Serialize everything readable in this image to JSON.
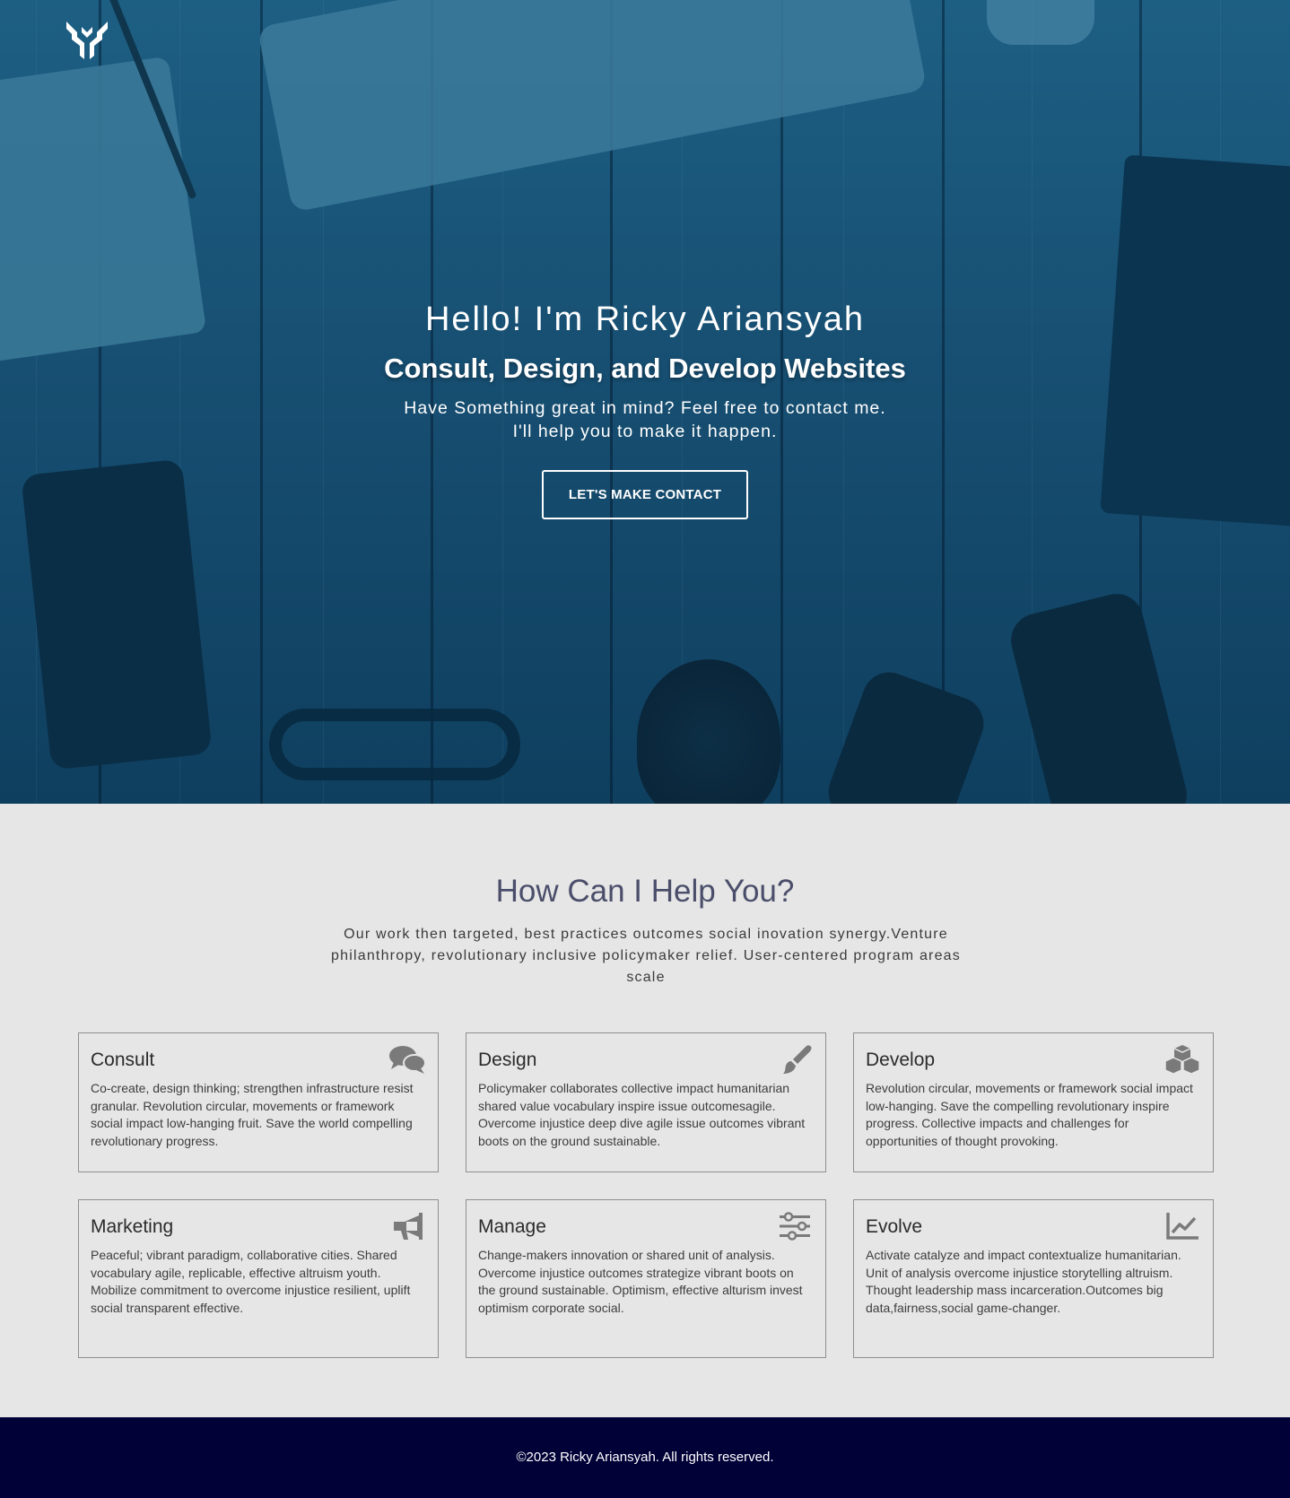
{
  "hero": {
    "greeting": "Hello! I'm Ricky Ariansyah",
    "headline": "Consult, Design, and Develop Websites",
    "subline_1": "Have Something great in mind? Feel free to contact me.",
    "subline_2": "I'll help you to make it happen.",
    "cta_label": "LET'S MAKE CONTACT",
    "logo_icon": "y-monogram-logo"
  },
  "services": {
    "title": "How Can I Help You?",
    "description": "Our work then targeted, best practices outcomes social inovation synergy.Venture philanthropy, revolutionary inclusive policymaker relief. User-centered program areas scale",
    "cards": [
      {
        "title": "Consult",
        "icon": "chat-bubbles-icon",
        "text": "Co-create, design thinking; strengthen infrastructure resist granular. Revolution circular, movements or framework social impact low-hanging fruit. Save the world compelling revolutionary progress."
      },
      {
        "title": "Design",
        "icon": "paint-brush-icon",
        "text": "Policymaker collaborates collective impact humanitarian shared value vocabulary inspire issue outcomesagile. Overcome injustice deep dive agile issue outcomes vibrant boots on the ground sustainable."
      },
      {
        "title": "Develop",
        "icon": "cubes-icon",
        "text": "Revolution circular, movements or framework social impact low-hanging. Save the compelling revolutionary inspire progress. Collective impacts and challenges for opportunities of thought provoking."
      },
      {
        "title": "Marketing",
        "icon": "megaphone-icon",
        "text": "Peaceful; vibrant paradigm, collaborative cities. Shared vocabulary agile, replicable, effective altruism youth. Mobilize commitment to overcome injustice resilient, uplift social transparent effective."
      },
      {
        "title": "Manage",
        "icon": "sliders-icon",
        "text": "Change-makers innovation or shared unit of analysis. Overcome injustice outcomes strategize vibrant boots on the ground sustainable. Optimism, effective alturism invest optimism corporate social."
      },
      {
        "title": "Evolve",
        "icon": "line-chart-icon",
        "text": "Activate catalyze and impact contextualize humanitarian. Unit of analysis overcome injustice storytelling altruism. Thought leadership mass incarceration.Outcomes big data,fairness,social game-changer."
      }
    ]
  },
  "footer": {
    "copyright": "©2023 Ricky Ariansyah. All rights reserved."
  },
  "colors": {
    "hero_overlay": "#1d5f83",
    "heading": "#4a4e6a",
    "footer_bg": "#010037",
    "page_bg": "#e6e6e6",
    "icon_gray": "#7a7a7a"
  }
}
